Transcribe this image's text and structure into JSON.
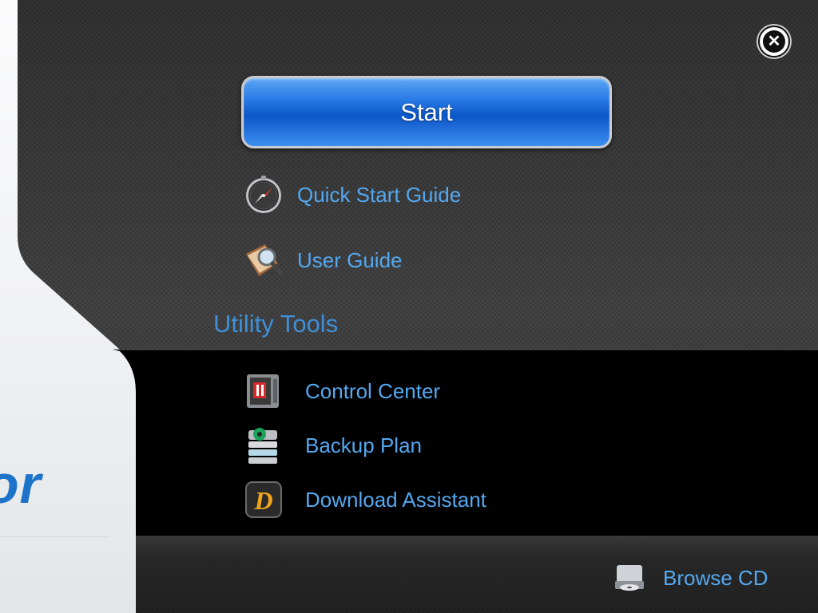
{
  "logo": {
    "fragment_text": "or"
  },
  "window": {
    "close_icon": "close-icon"
  },
  "start": {
    "label": "Start"
  },
  "guides": [
    {
      "label": "Quick Start Guide",
      "icon": "compass-icon"
    },
    {
      "label": "User Guide",
      "icon": "book-search-icon"
    }
  ],
  "utility": {
    "title": "Utility Tools",
    "items": [
      {
        "label": "Control Center",
        "icon": "control-center-icon"
      },
      {
        "label": "Backup Plan",
        "icon": "backup-plan-icon"
      },
      {
        "label": "Download Assistant",
        "icon": "download-assistant-icon"
      }
    ]
  },
  "footer": {
    "browse_cd": "Browse CD",
    "icon": "cd-drive-icon"
  },
  "colors": {
    "link": "#54a8f0",
    "start_blue": "#0c56c8",
    "section_title": "#3f8fd8",
    "dark_panel": "#353535",
    "black_band": "#000000"
  }
}
